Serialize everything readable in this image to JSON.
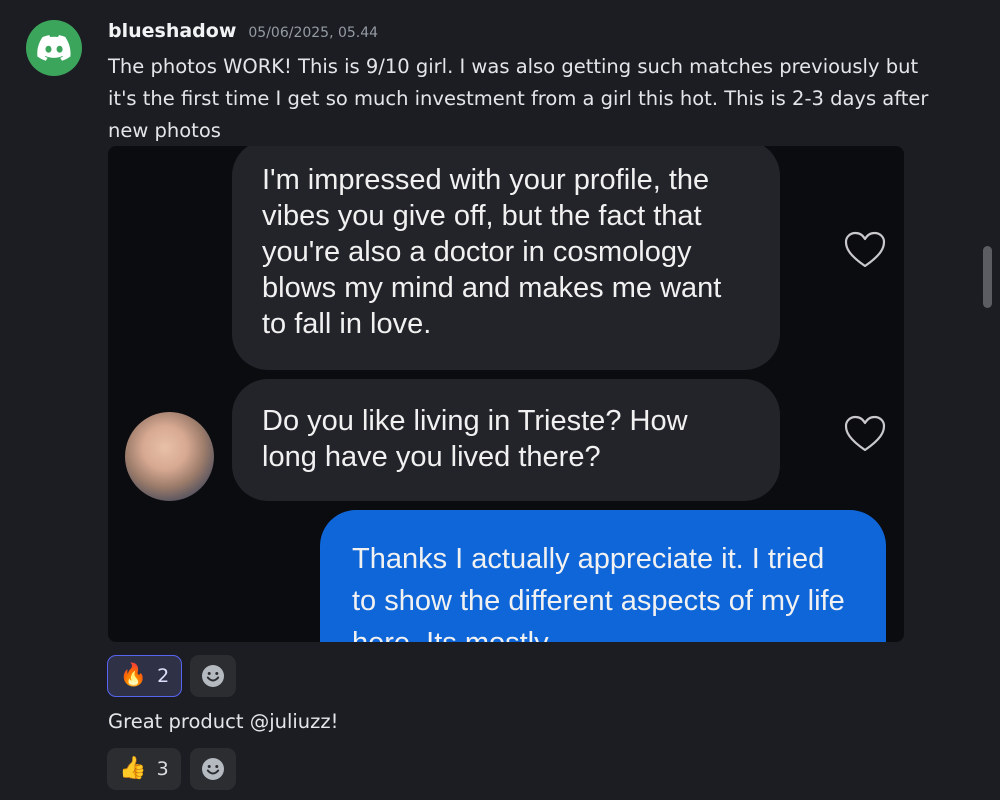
{
  "message": {
    "username": "blueshadow",
    "timestamp": "05/06/2025, 05.44",
    "text": "The photos WORK! This is 9/10 girl. I was also getting such matches previously but it's the first time I get so much investment from a girl this hot. This is 2-3 days after new photos",
    "attachment": {
      "bubble_1": "I'm impressed with your profile, the vibes you give off, but the fact that you're also a doctor in cosmology blows my mind and makes me want to fall in love.",
      "bubble_2": "Do you like living in Trieste? How long have you lived there?",
      "bubble_3": "Thanks I actually appreciate it. I tried to show the different aspects of my life here. Its mostly"
    },
    "reactions": [
      {
        "emoji": "🔥",
        "count": "2",
        "selected": true
      }
    ]
  },
  "message2": {
    "text": "Great product @juliuzz!",
    "reactions": [
      {
        "emoji": "👍",
        "count": "3",
        "selected": false
      }
    ]
  },
  "colors": {
    "avatar_bg": "#3ba55c",
    "sent_bubble": "#0e66d9",
    "received_bubble": "#22242a"
  }
}
